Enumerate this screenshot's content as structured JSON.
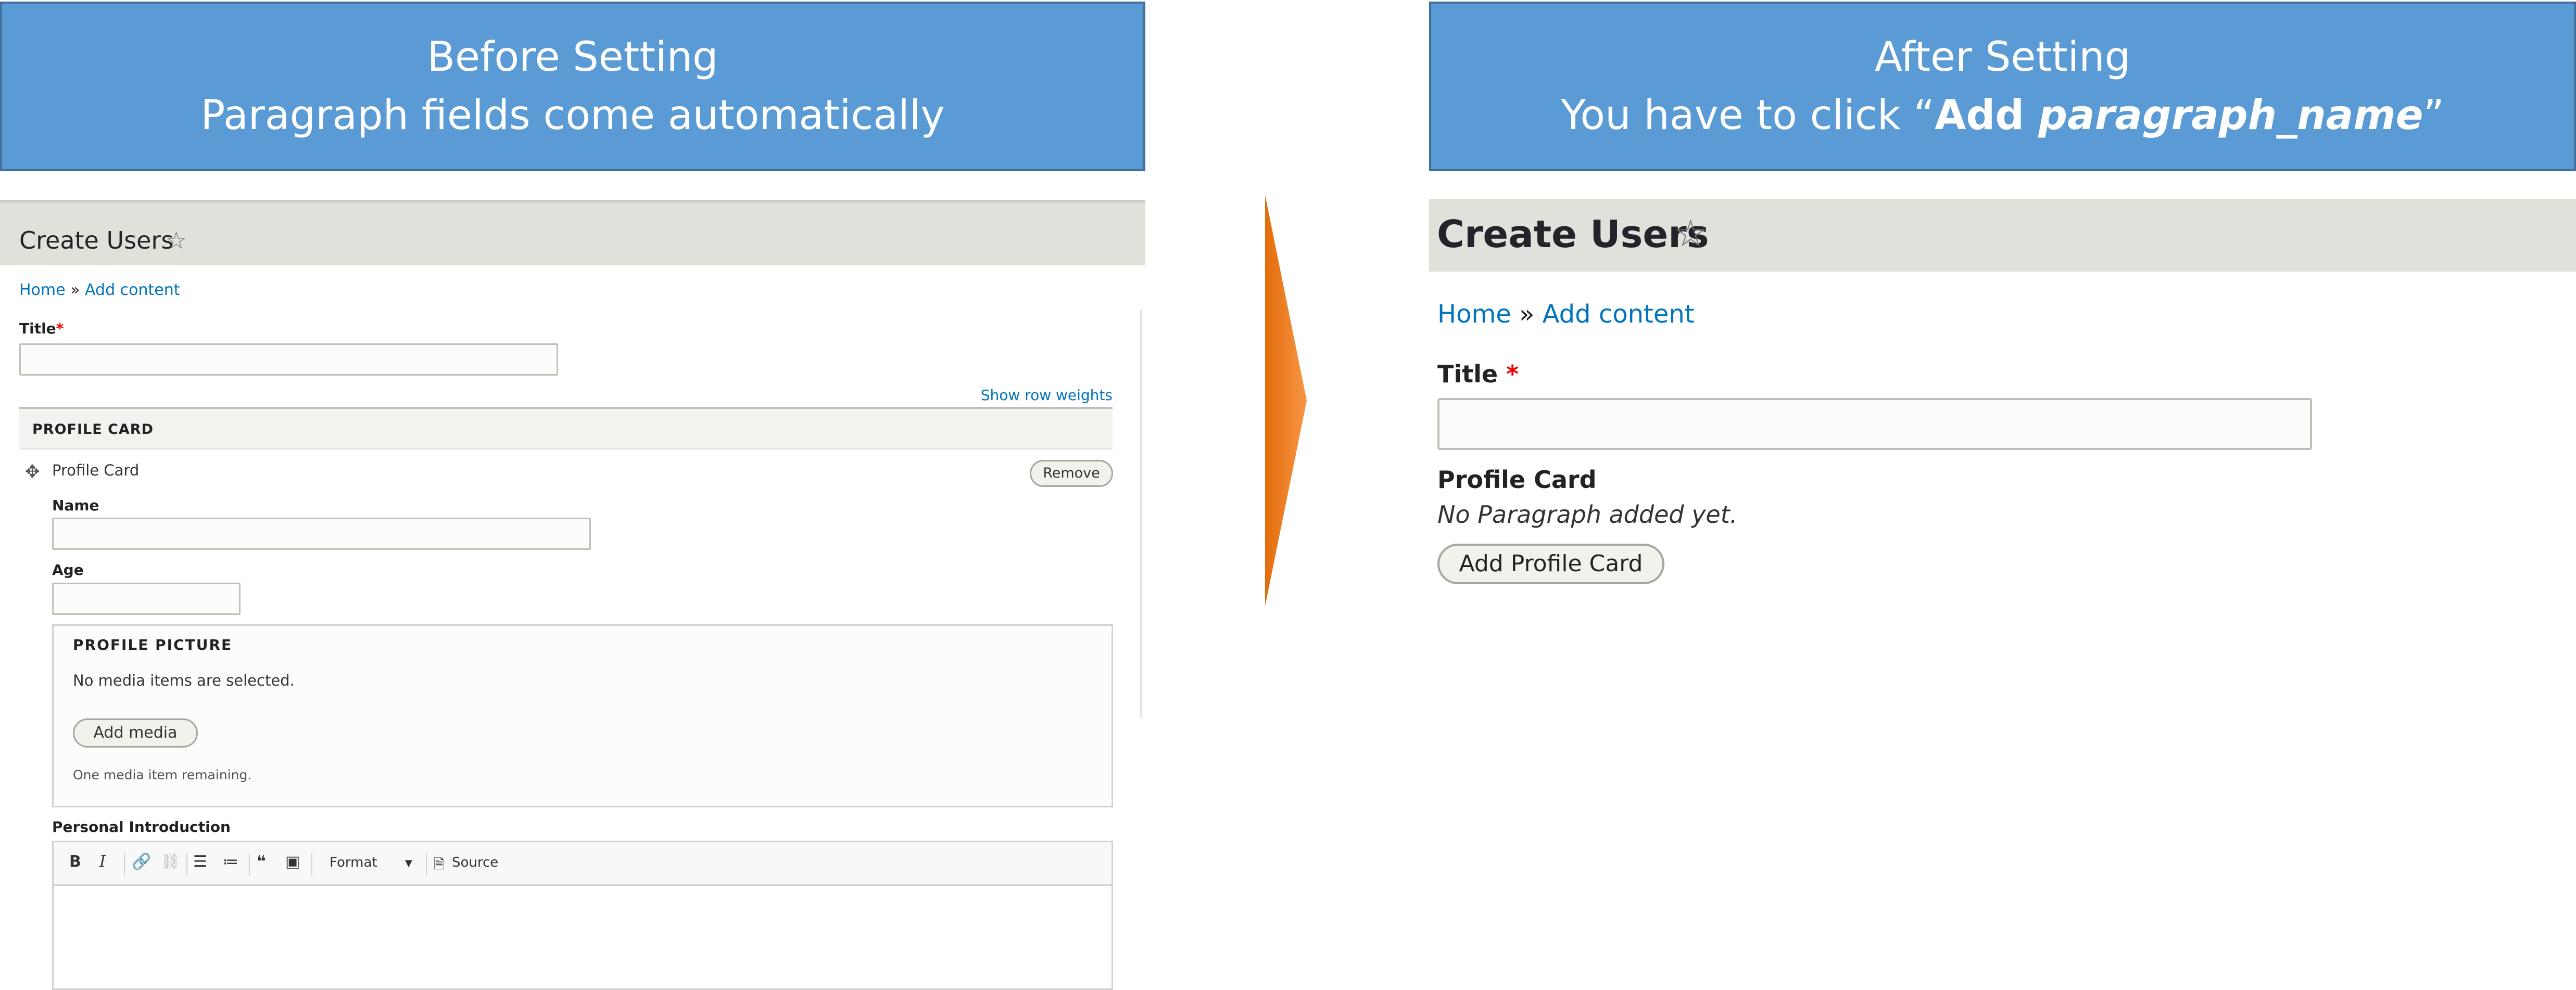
{
  "left_banner": {
    "line1": "Before Setting",
    "line2": "Paragraph fields come automatically"
  },
  "right_banner": {
    "prefix": "You have to click “",
    "bold": "Add ",
    "bold_italic": "paragraph_name",
    "suffix": "”",
    "line1": "After Setting"
  },
  "before": {
    "page_title": "Create Users",
    "breadcrumb": {
      "home": "Home",
      "sep": "»",
      "current": "Add content"
    },
    "title_label": "Title",
    "required_mark": "*",
    "show_row_weights": "Show row weights",
    "table_header": "PROFILE CARD",
    "row_title": "Profile Card",
    "remove_button": "Remove",
    "name_label": "Name",
    "age_label": "Age",
    "profile_picture": {
      "legend": "PROFILE PICTURE",
      "empty_text": "No media items are selected.",
      "add_media_button": "Add media",
      "remaining": "One media item remaining."
    },
    "intro_label": "Personal Introduction",
    "toolbar": {
      "format": "Format",
      "source": "Source"
    }
  },
  "after": {
    "page_title": "Create Users",
    "breadcrumb": {
      "home": "Home",
      "sep": "»",
      "current": "Add content"
    },
    "title_label": "Title",
    "required_mark": "*",
    "profile_label": "Profile Card",
    "empty_text": "No Paragraph added yet.",
    "add_button": "Add Profile Card"
  },
  "colors": {
    "banner_fill": "#5b9bd5",
    "link": "#0074bd",
    "arrow_start": "#f79646",
    "arrow_end": "#e36c0a",
    "required": "#e00000"
  }
}
